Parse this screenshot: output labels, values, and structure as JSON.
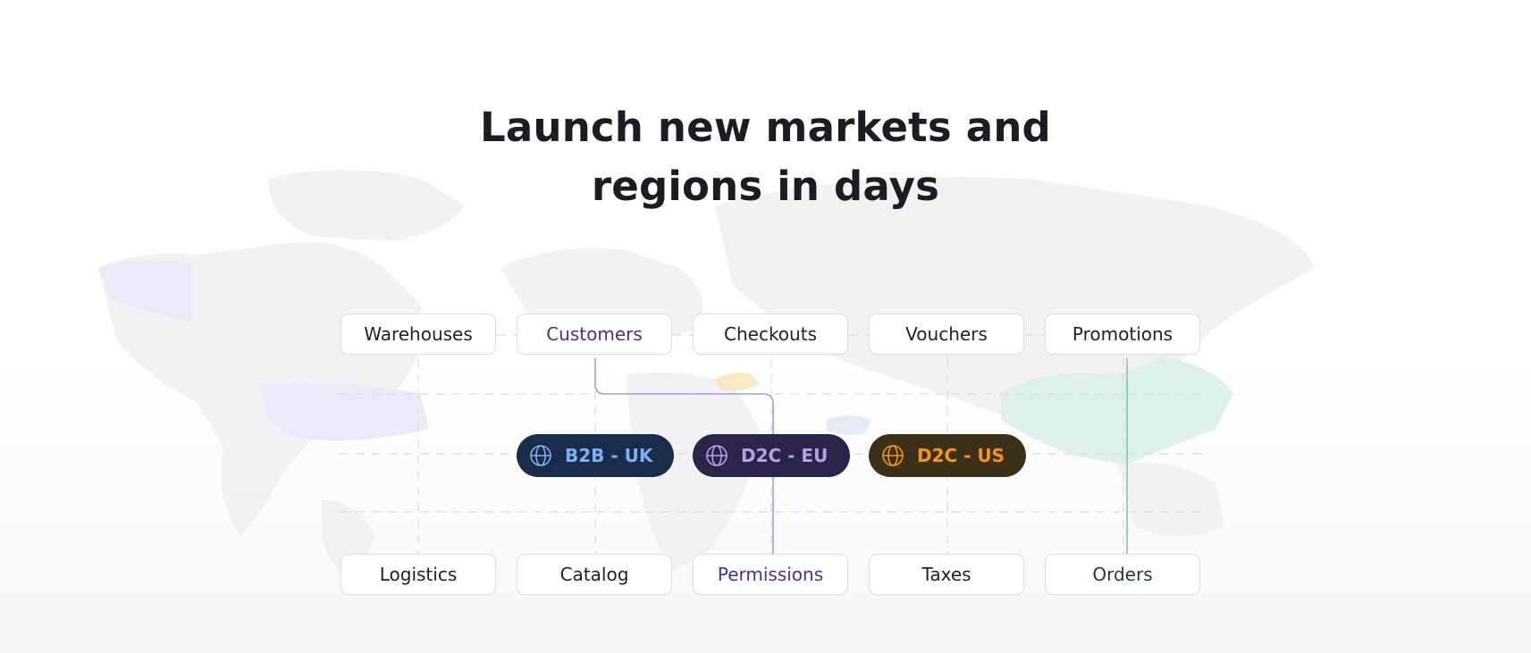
{
  "headline": {
    "line1": "Launch new markets and",
    "line2": "regions in days"
  },
  "top_nodes": [
    {
      "label": "Warehouses"
    },
    {
      "label": "Customers"
    },
    {
      "label": "Checkouts"
    },
    {
      "label": "Vouchers"
    },
    {
      "label": "Promotions"
    }
  ],
  "regions": [
    {
      "label": "B2B - UK",
      "icon": "globe-icon",
      "background": "#1b2c4a",
      "color": "#7cb2f2"
    },
    {
      "label": "D2C - EU",
      "icon": "globe-icon",
      "background": "#2c2448",
      "color": "#b89ee8"
    },
    {
      "label": "D2C - US",
      "icon": "globe-icon",
      "background": "#3d3018",
      "color": "#f3961f"
    }
  ],
  "bottom_nodes": [
    {
      "label": "Logistics"
    },
    {
      "label": "Catalog"
    },
    {
      "label": "Permissions"
    },
    {
      "label": "Taxes"
    },
    {
      "label": "Orders"
    }
  ],
  "colors": {
    "purple_connector": "#a99ae6",
    "green_connector": "#7fcaa0",
    "guide_lines": "#dcdce0",
    "active_purple_text": "#4b2e8f",
    "active_green_text": "#1d3a33"
  }
}
